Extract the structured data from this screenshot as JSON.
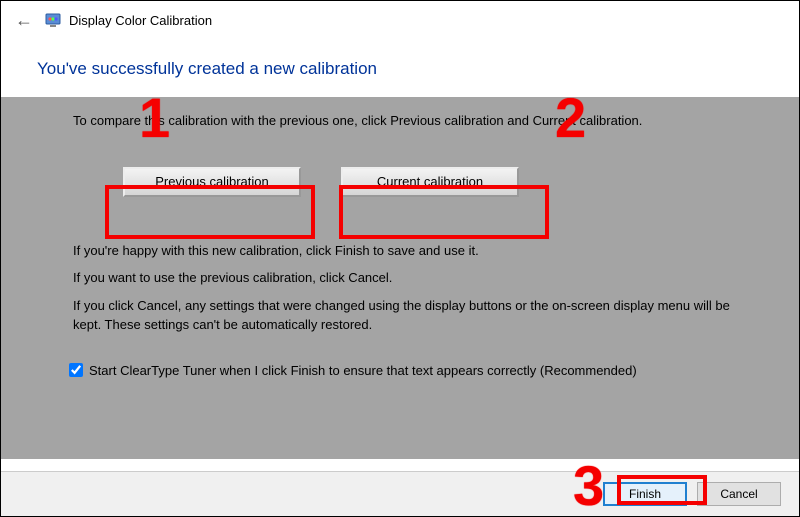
{
  "title": "Display Color Calibration",
  "heading": "You've successfully created a new calibration",
  "compare_text": "To compare this calibration with the previous one, click Previous calibration and Current calibration.",
  "buttons": {
    "previous": "Previous calibration",
    "current": "Current calibration"
  },
  "paragraphs": {
    "happy": "If you're happy with this new calibration, click Finish to save and use it.",
    "previous": "If you want to use the previous calibration, click Cancel.",
    "cancel_note": "If you click Cancel, any settings that were changed using the display buttons or the on-screen display menu will be kept. These settings can't be automatically restored."
  },
  "checkbox": {
    "checked": true,
    "label": "Start ClearType Tuner when I click Finish to ensure that text appears correctly (Recommended)"
  },
  "footer": {
    "finish": "Finish",
    "cancel": "Cancel"
  },
  "annotations": {
    "n1": "1",
    "n2": "2",
    "n3": "3"
  }
}
